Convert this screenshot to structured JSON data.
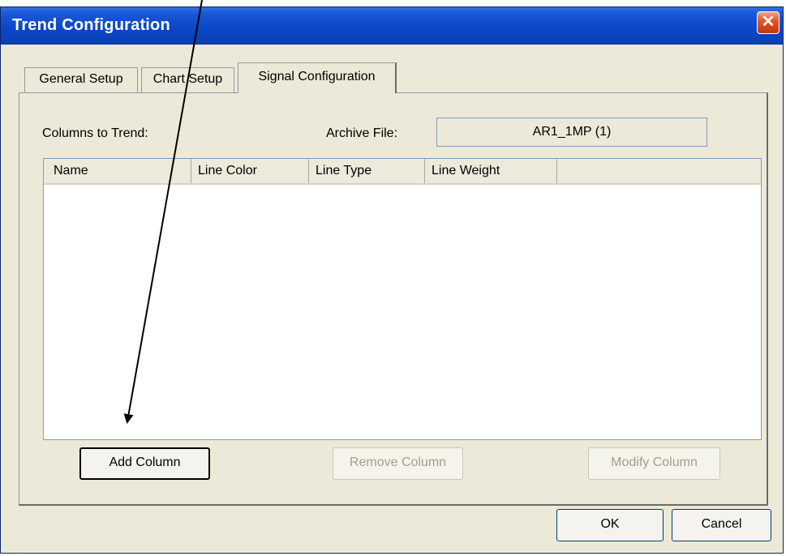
{
  "window": {
    "title": "Trend Configuration",
    "close_symbol": "✕"
  },
  "tabs": [
    {
      "label": "General Setup",
      "selected": false
    },
    {
      "label": "Chart Setup",
      "selected": false
    },
    {
      "label": "Signal Configuration",
      "selected": true
    }
  ],
  "signal_config": {
    "columns_label": "Columns to Trend:",
    "archive_label": "Archive File:",
    "archive_value": "AR1_1MP  (1)",
    "list_columns": [
      "Name",
      "Line Color",
      "Line Type",
      "Line Weight",
      ""
    ],
    "rows": [],
    "add_button": "Add Column",
    "remove_button": "Remove Column",
    "modify_button": "Modify Column"
  },
  "footer": {
    "ok": "OK",
    "cancel": "Cancel"
  },
  "icons": {
    "close": "close-icon",
    "annotation": "annotation-arrow"
  },
  "colors": {
    "titlebar": "#0a48c8",
    "face": "#ece9d8",
    "close": "#e4572b",
    "disabled_text": "#a19f8f"
  }
}
